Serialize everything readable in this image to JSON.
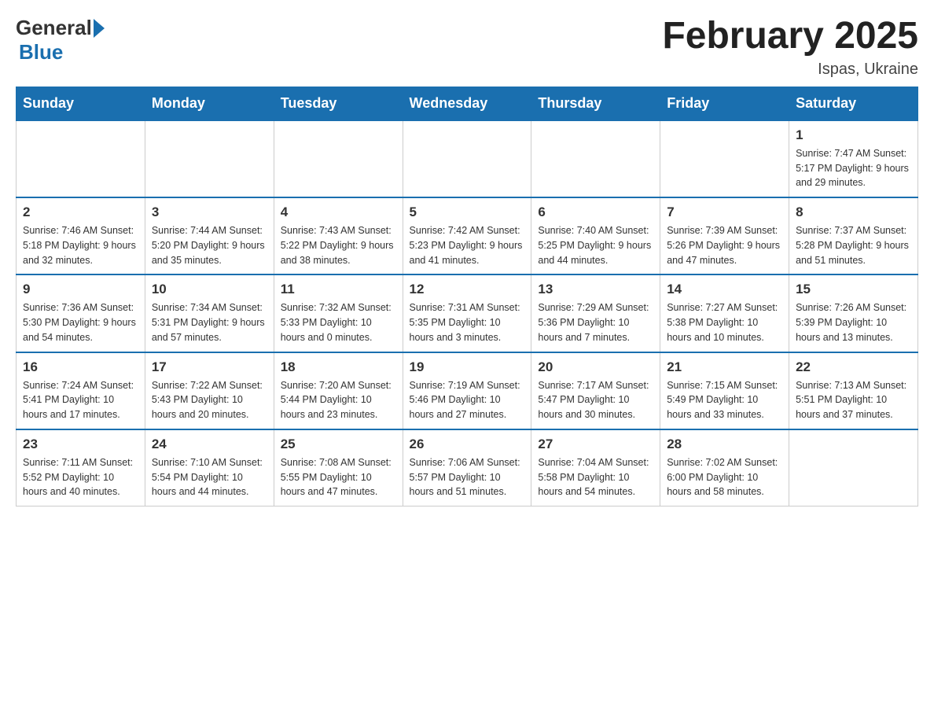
{
  "header": {
    "logo_general": "General",
    "logo_blue": "Blue",
    "month_title": "February 2025",
    "location": "Ispas, Ukraine"
  },
  "days_of_week": [
    "Sunday",
    "Monday",
    "Tuesday",
    "Wednesday",
    "Thursday",
    "Friday",
    "Saturday"
  ],
  "weeks": [
    {
      "days": [
        {
          "number": "",
          "info": "",
          "empty": true
        },
        {
          "number": "",
          "info": "",
          "empty": true
        },
        {
          "number": "",
          "info": "",
          "empty": true
        },
        {
          "number": "",
          "info": "",
          "empty": true
        },
        {
          "number": "",
          "info": "",
          "empty": true
        },
        {
          "number": "",
          "info": "",
          "empty": true
        },
        {
          "number": "1",
          "info": "Sunrise: 7:47 AM\nSunset: 5:17 PM\nDaylight: 9 hours and 29 minutes.",
          "empty": false
        }
      ]
    },
    {
      "days": [
        {
          "number": "2",
          "info": "Sunrise: 7:46 AM\nSunset: 5:18 PM\nDaylight: 9 hours and 32 minutes.",
          "empty": false
        },
        {
          "number": "3",
          "info": "Sunrise: 7:44 AM\nSunset: 5:20 PM\nDaylight: 9 hours and 35 minutes.",
          "empty": false
        },
        {
          "number": "4",
          "info": "Sunrise: 7:43 AM\nSunset: 5:22 PM\nDaylight: 9 hours and 38 minutes.",
          "empty": false
        },
        {
          "number": "5",
          "info": "Sunrise: 7:42 AM\nSunset: 5:23 PM\nDaylight: 9 hours and 41 minutes.",
          "empty": false
        },
        {
          "number": "6",
          "info": "Sunrise: 7:40 AM\nSunset: 5:25 PM\nDaylight: 9 hours and 44 minutes.",
          "empty": false
        },
        {
          "number": "7",
          "info": "Sunrise: 7:39 AM\nSunset: 5:26 PM\nDaylight: 9 hours and 47 minutes.",
          "empty": false
        },
        {
          "number": "8",
          "info": "Sunrise: 7:37 AM\nSunset: 5:28 PM\nDaylight: 9 hours and 51 minutes.",
          "empty": false
        }
      ]
    },
    {
      "days": [
        {
          "number": "9",
          "info": "Sunrise: 7:36 AM\nSunset: 5:30 PM\nDaylight: 9 hours and 54 minutes.",
          "empty": false
        },
        {
          "number": "10",
          "info": "Sunrise: 7:34 AM\nSunset: 5:31 PM\nDaylight: 9 hours and 57 minutes.",
          "empty": false
        },
        {
          "number": "11",
          "info": "Sunrise: 7:32 AM\nSunset: 5:33 PM\nDaylight: 10 hours and 0 minutes.",
          "empty": false
        },
        {
          "number": "12",
          "info": "Sunrise: 7:31 AM\nSunset: 5:35 PM\nDaylight: 10 hours and 3 minutes.",
          "empty": false
        },
        {
          "number": "13",
          "info": "Sunrise: 7:29 AM\nSunset: 5:36 PM\nDaylight: 10 hours and 7 minutes.",
          "empty": false
        },
        {
          "number": "14",
          "info": "Sunrise: 7:27 AM\nSunset: 5:38 PM\nDaylight: 10 hours and 10 minutes.",
          "empty": false
        },
        {
          "number": "15",
          "info": "Sunrise: 7:26 AM\nSunset: 5:39 PM\nDaylight: 10 hours and 13 minutes.",
          "empty": false
        }
      ]
    },
    {
      "days": [
        {
          "number": "16",
          "info": "Sunrise: 7:24 AM\nSunset: 5:41 PM\nDaylight: 10 hours and 17 minutes.",
          "empty": false
        },
        {
          "number": "17",
          "info": "Sunrise: 7:22 AM\nSunset: 5:43 PM\nDaylight: 10 hours and 20 minutes.",
          "empty": false
        },
        {
          "number": "18",
          "info": "Sunrise: 7:20 AM\nSunset: 5:44 PM\nDaylight: 10 hours and 23 minutes.",
          "empty": false
        },
        {
          "number": "19",
          "info": "Sunrise: 7:19 AM\nSunset: 5:46 PM\nDaylight: 10 hours and 27 minutes.",
          "empty": false
        },
        {
          "number": "20",
          "info": "Sunrise: 7:17 AM\nSunset: 5:47 PM\nDaylight: 10 hours and 30 minutes.",
          "empty": false
        },
        {
          "number": "21",
          "info": "Sunrise: 7:15 AM\nSunset: 5:49 PM\nDaylight: 10 hours and 33 minutes.",
          "empty": false
        },
        {
          "number": "22",
          "info": "Sunrise: 7:13 AM\nSunset: 5:51 PM\nDaylight: 10 hours and 37 minutes.",
          "empty": false
        }
      ]
    },
    {
      "days": [
        {
          "number": "23",
          "info": "Sunrise: 7:11 AM\nSunset: 5:52 PM\nDaylight: 10 hours and 40 minutes.",
          "empty": false
        },
        {
          "number": "24",
          "info": "Sunrise: 7:10 AM\nSunset: 5:54 PM\nDaylight: 10 hours and 44 minutes.",
          "empty": false
        },
        {
          "number": "25",
          "info": "Sunrise: 7:08 AM\nSunset: 5:55 PM\nDaylight: 10 hours and 47 minutes.",
          "empty": false
        },
        {
          "number": "26",
          "info": "Sunrise: 7:06 AM\nSunset: 5:57 PM\nDaylight: 10 hours and 51 minutes.",
          "empty": false
        },
        {
          "number": "27",
          "info": "Sunrise: 7:04 AM\nSunset: 5:58 PM\nDaylight: 10 hours and 54 minutes.",
          "empty": false
        },
        {
          "number": "28",
          "info": "Sunrise: 7:02 AM\nSunset: 6:00 PM\nDaylight: 10 hours and 58 minutes.",
          "empty": false
        },
        {
          "number": "",
          "info": "",
          "empty": true
        }
      ]
    }
  ]
}
